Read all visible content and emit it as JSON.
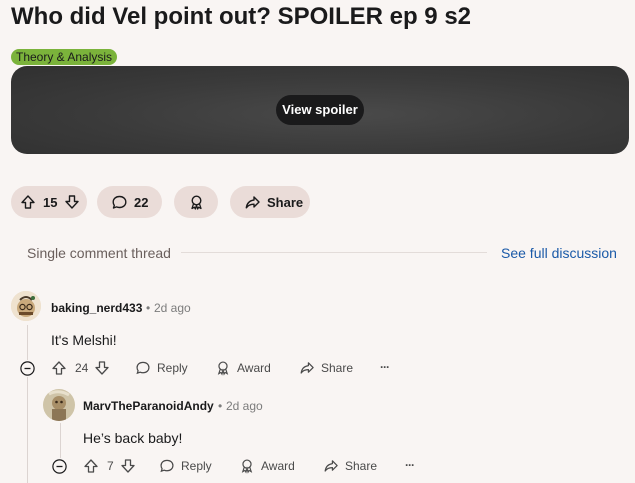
{
  "post": {
    "title": "Who did Vel point out? SPOILER ep 9 s2",
    "flair": "Theory & Analysis",
    "spoiler_button": "View spoiler"
  },
  "actions": {
    "votes": "15",
    "comments": "22",
    "share": "Share"
  },
  "thread": {
    "label": "Single comment thread",
    "see_full": "See full discussion"
  },
  "comments": [
    {
      "user": "baking_nerd433",
      "sep": "•",
      "time": "2d ago",
      "text": "It's Melshi!",
      "votes": "24",
      "reply": "Reply",
      "award": "Award",
      "share": "Share",
      "more": "···"
    },
    {
      "user": "MarvTheParanoidAndy",
      "sep": "•",
      "time": "2d ago",
      "text": "He’s back baby!",
      "votes": "7",
      "reply": "Reply",
      "award": "Award",
      "share": "Share",
      "more": "···"
    }
  ],
  "colors": {
    "background": "#f9f5f3",
    "flair": "#7bb33b",
    "pill": "#eadcd8",
    "link": "#1b5aa8"
  }
}
